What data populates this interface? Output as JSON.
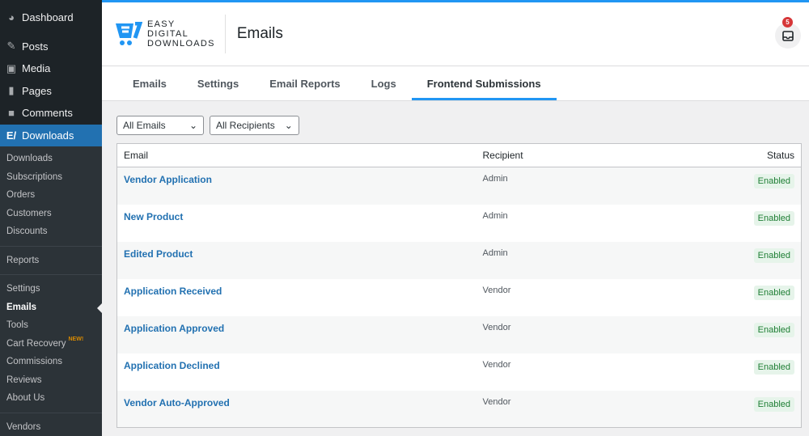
{
  "sidebar": {
    "top": [
      {
        "label": "Dashboard",
        "icon": "dashboard-icon"
      },
      {
        "label": "Posts",
        "icon": "pin-icon"
      },
      {
        "label": "Media",
        "icon": "media-icon"
      },
      {
        "label": "Pages",
        "icon": "pages-icon"
      },
      {
        "label": "Comments",
        "icon": "comment-icon"
      },
      {
        "label": "Downloads",
        "icon": "edd-cart-icon"
      }
    ],
    "sub": [
      "Downloads",
      "Subscriptions",
      "Orders",
      "Customers",
      "Discounts",
      "Reports",
      "Settings",
      "Emails",
      "Tools",
      "Cart Recovery",
      "Commissions",
      "Reviews",
      "About Us",
      "Vendors"
    ],
    "new_badge": "NEW!"
  },
  "header": {
    "logo": "EASY DIGITAL DOWNLOADS",
    "logo_lines": [
      "EASY",
      "DIGITAL",
      "DOWNLOADS"
    ],
    "title": "Emails",
    "notifications": "5"
  },
  "tabs": [
    "Emails",
    "Settings",
    "Email Reports",
    "Logs",
    "Frontend Submissions"
  ],
  "filters": {
    "type": "All Emails",
    "recipients": "All Recipients"
  },
  "table": {
    "headers": [
      "Email",
      "Recipient",
      "Status"
    ],
    "rows": [
      [
        "Vendor Application",
        "Admin",
        "Enabled"
      ],
      [
        "New Product",
        "Admin",
        "Enabled"
      ],
      [
        "Edited Product",
        "Admin",
        "Enabled"
      ],
      [
        "Application Received",
        "Vendor",
        "Enabled"
      ],
      [
        "Application Approved",
        "Vendor",
        "Enabled"
      ],
      [
        "Application Declined",
        "Vendor",
        "Enabled"
      ],
      [
        "Vendor Auto-Approved",
        "Vendor",
        "Enabled"
      ]
    ]
  },
  "colors": {
    "accent": "#2196f3",
    "wp_blue": "#2271b1",
    "enabled_bg": "#e6f4ea"
  }
}
